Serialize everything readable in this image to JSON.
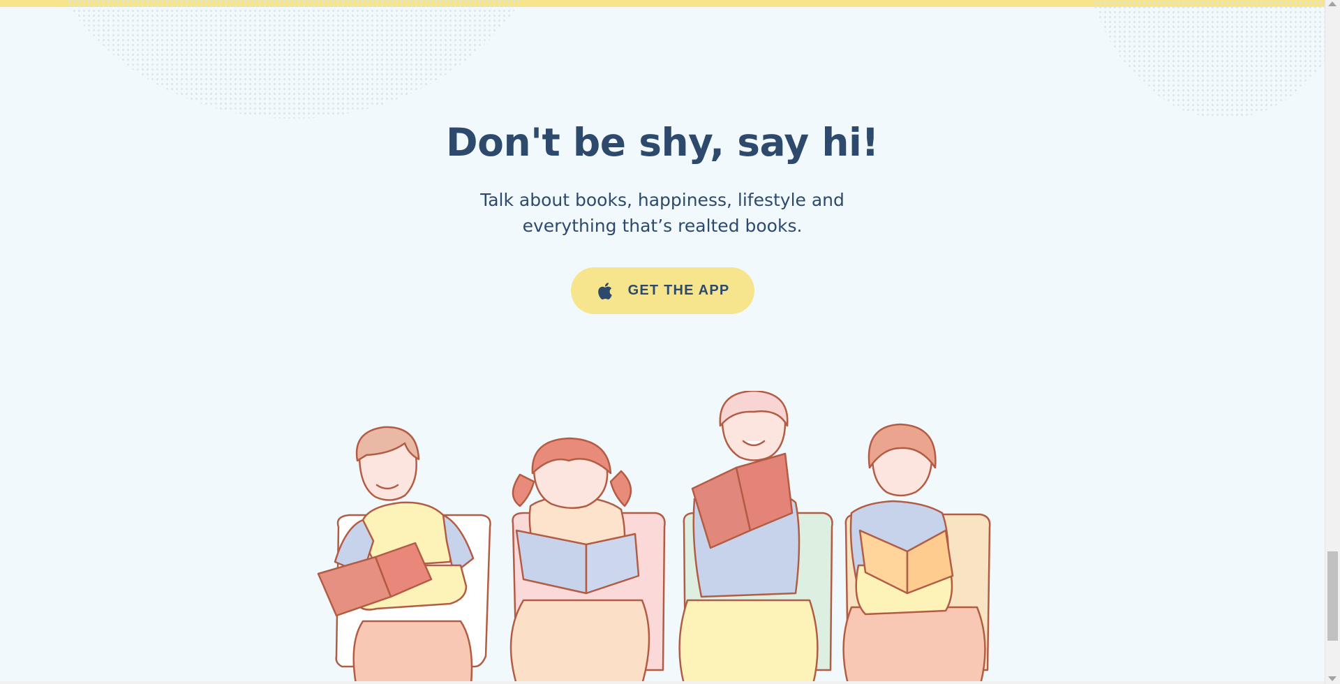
{
  "colors": {
    "background": "#f1f9fd",
    "accent_yellow": "#f6e58d",
    "heading_text": "#2d4a6d"
  },
  "hero": {
    "heading": "Don't be shy, say hi!",
    "subtext_line1": "Talk about books, happiness, lifestyle and",
    "subtext_line2": "everything that’s realted books."
  },
  "cta": {
    "icon": "apple-icon",
    "label": "GET THE APP"
  },
  "illustration": {
    "description_icon": "kids-reading-books-illustration"
  },
  "scrollbar": {
    "position_fraction": 0.95
  }
}
